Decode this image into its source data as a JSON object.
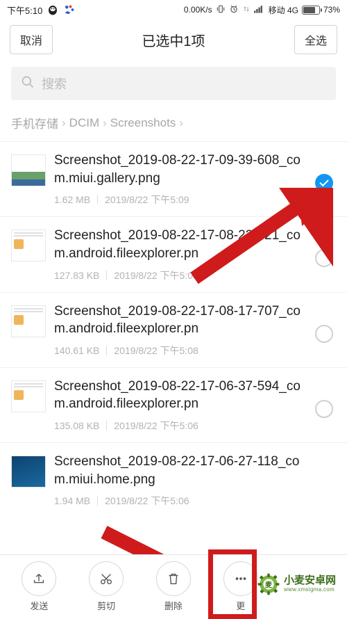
{
  "status_bar": {
    "time": "下午5:10",
    "net_speed": "0.00K/s",
    "carrier": "移动 4G",
    "battery_pct": "73%"
  },
  "header": {
    "cancel": "取消",
    "title": "已选中1项",
    "select_all": "全选"
  },
  "search": {
    "placeholder": "搜索"
  },
  "breadcrumb": {
    "items": [
      "手机存储",
      "DCIM",
      "Screenshots"
    ]
  },
  "files": [
    {
      "name": "Screenshot_2019-08-22-17-09-39-608_com.miui.gallery.png",
      "size": "1.62 MB",
      "date": "2019/8/22 下午5:09",
      "selected": true,
      "thumb": "gallery"
    },
    {
      "name": "Screenshot_2019-08-22-17-08-22-421_com.android.fileexplorer.pn",
      "size": "127.83 KB",
      "date": "2019/8/22 下午5:08",
      "selected": false,
      "thumb": "fe"
    },
    {
      "name": "Screenshot_2019-08-22-17-08-17-707_com.android.fileexplorer.pn",
      "size": "140.61 KB",
      "date": "2019/8/22 下午5:08",
      "selected": false,
      "thumb": "fe"
    },
    {
      "name": "Screenshot_2019-08-22-17-06-37-594_com.android.fileexplorer.pn",
      "size": "135.08 KB",
      "date": "2019/8/22 下午5:06",
      "selected": false,
      "thumb": "fe"
    },
    {
      "name": "Screenshot_2019-08-22-17-06-27-118_com.miui.home.png",
      "size": "1.94 MB",
      "date": "2019/8/22 下午5:06",
      "selected": false,
      "thumb": "home"
    }
  ],
  "toolbar": {
    "send": "发送",
    "cut": "剪切",
    "delete": "删除",
    "more": "更"
  },
  "watermark": {
    "brand": "小麦安卓网",
    "domain": "www.xmsigma.com"
  },
  "colors": {
    "accent": "#1196f3",
    "annotation": "#cf1b1b"
  }
}
